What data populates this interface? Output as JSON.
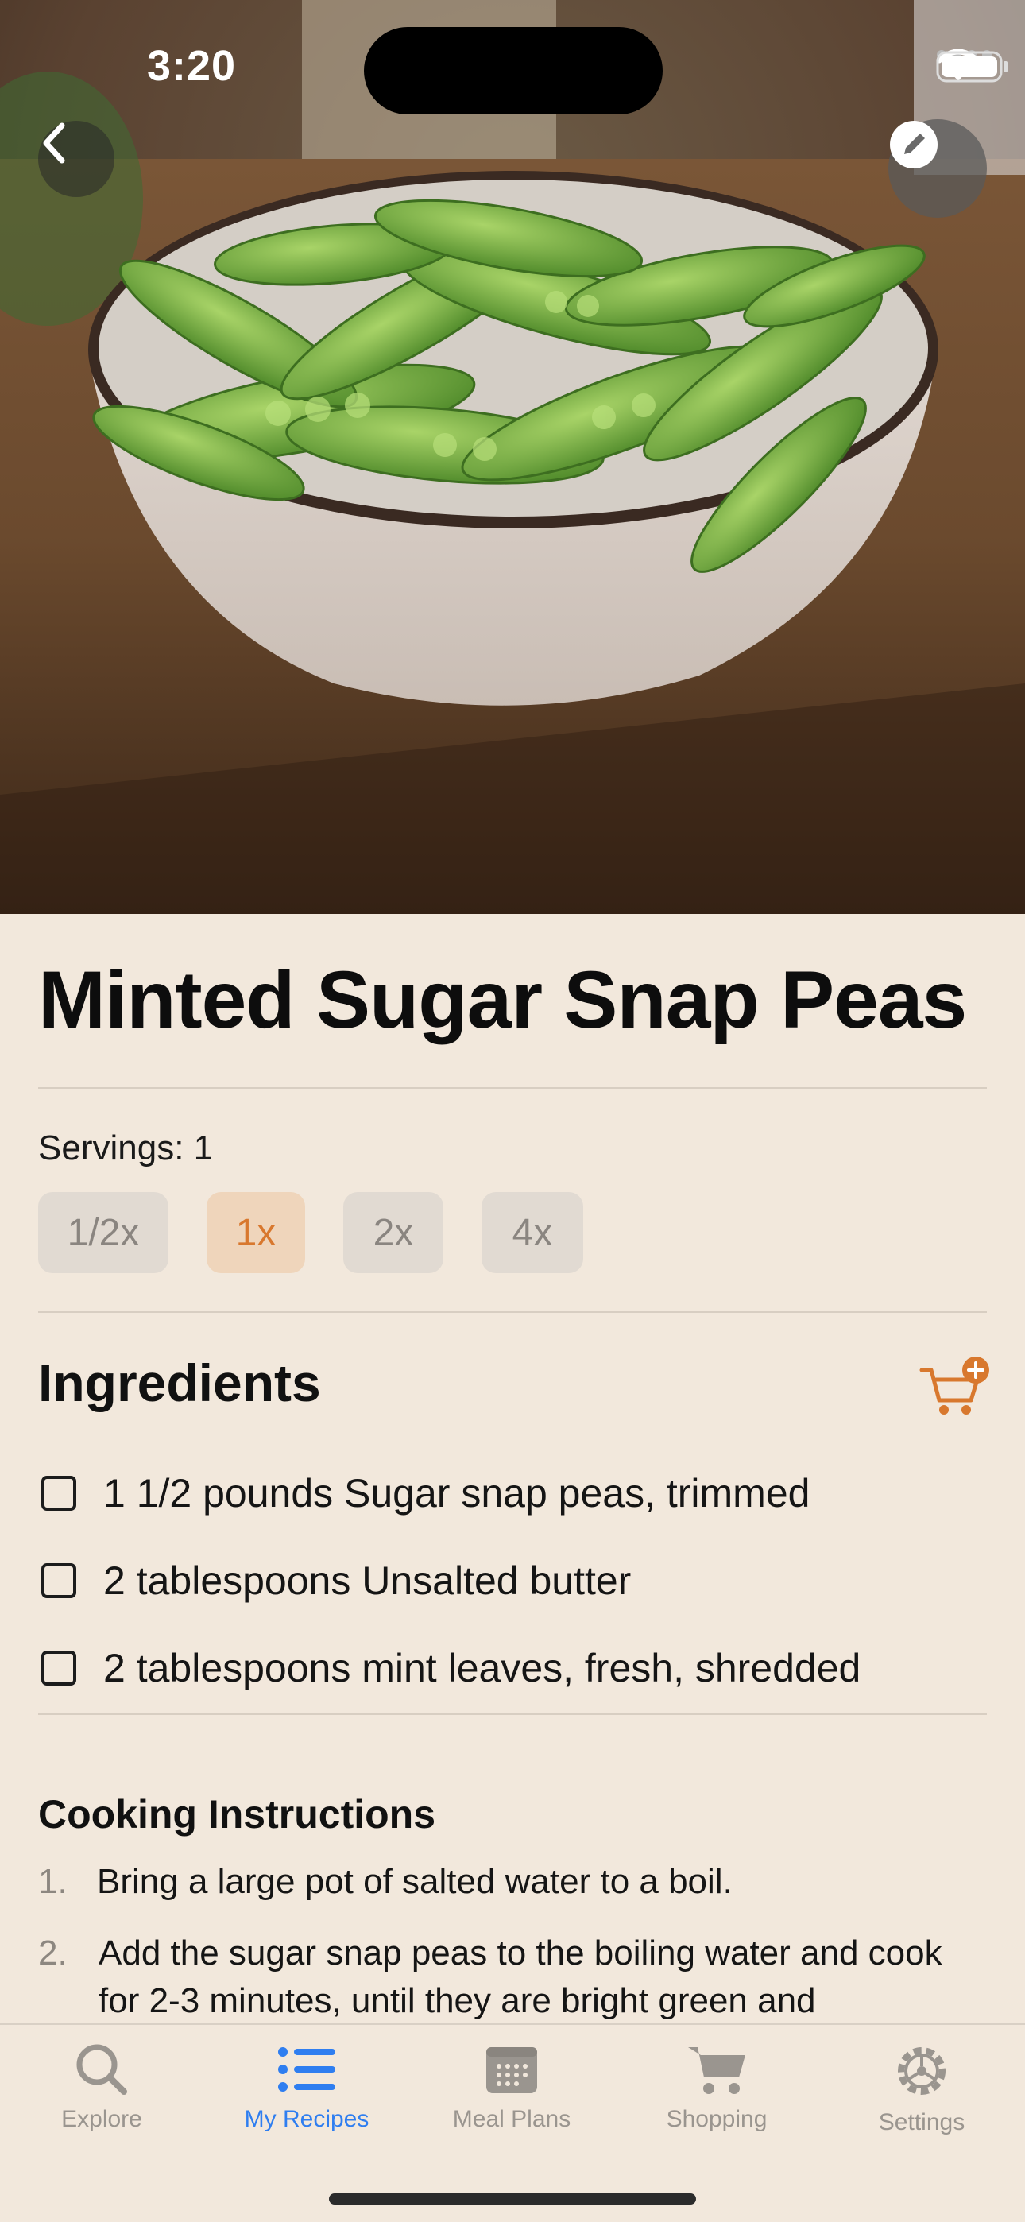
{
  "status_bar": {
    "time": "3:20"
  },
  "header": {
    "back_icon": "chevron-left-icon",
    "edit_icon": "pencil-icon"
  },
  "recipe": {
    "title": "Minted Sugar Snap Peas",
    "servings_label": "Servings: 1",
    "scale_options": [
      {
        "label": "1/2x",
        "selected": false
      },
      {
        "label": "1x",
        "selected": true
      },
      {
        "label": "2x",
        "selected": false
      },
      {
        "label": "4x",
        "selected": false
      }
    ]
  },
  "ingredients": {
    "title": "Ingredients",
    "cart_icon": "add-to-cart-icon",
    "items": [
      {
        "text": "1 1/2 pounds Sugar snap peas, trimmed",
        "checked": false
      },
      {
        "text": "2 tablespoons Unsalted butter",
        "checked": false
      },
      {
        "text": "2 tablespoons mint leaves, fresh, shredded",
        "checked": false
      }
    ]
  },
  "instructions": {
    "title": "Cooking Instructions",
    "steps": [
      {
        "num": "1.",
        "text": "Bring a large pot of salted water to a boil."
      },
      {
        "num": "2.",
        "text": "Add the sugar snap peas to the boiling water and cook for 2-3 minutes, until they are bright green and"
      }
    ]
  },
  "tabs": [
    {
      "label": "Explore",
      "icon": "search-icon",
      "active": false
    },
    {
      "label": "My Recipes",
      "icon": "list-icon",
      "active": true
    },
    {
      "label": "Meal Plans",
      "icon": "calendar-icon",
      "active": false
    },
    {
      "label": "Shopping",
      "icon": "cart-icon",
      "active": false
    },
    {
      "label": "Settings",
      "icon": "gear-icon",
      "active": false
    }
  ],
  "colors": {
    "accent": "#d8782e",
    "tab_active": "#2f7ef0",
    "background": "#f2e8dc"
  }
}
